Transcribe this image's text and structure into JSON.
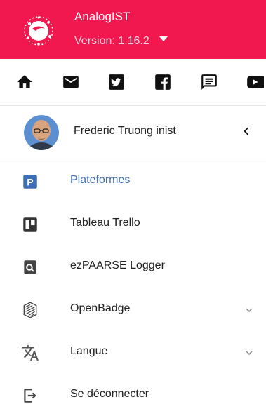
{
  "header": {
    "app_name": "AnalogIST",
    "version": "Version: 1.16.2",
    "background": "#f0184e"
  },
  "social_icons": [
    "home-icon",
    "mail-icon",
    "twitter-icon",
    "facebook-icon",
    "chat-icon",
    "youtube-icon"
  ],
  "user": {
    "name": "Frederic Truong inist"
  },
  "menu": {
    "items": [
      {
        "label": "Plateformes",
        "icon": "plateformes-icon",
        "active": true,
        "accent": "#3f6fb5"
      },
      {
        "label": "Tableau Trello",
        "icon": "trello-icon"
      },
      {
        "label": "ezPAARSE Logger",
        "icon": "ezpaarse-icon"
      },
      {
        "label": "OpenBadge",
        "icon": "openbadge-icon",
        "expandable": true
      },
      {
        "label": "Langue",
        "icon": "translate-icon",
        "expandable": true
      },
      {
        "label": "Se déconnecter",
        "icon": "logout-icon"
      }
    ]
  }
}
